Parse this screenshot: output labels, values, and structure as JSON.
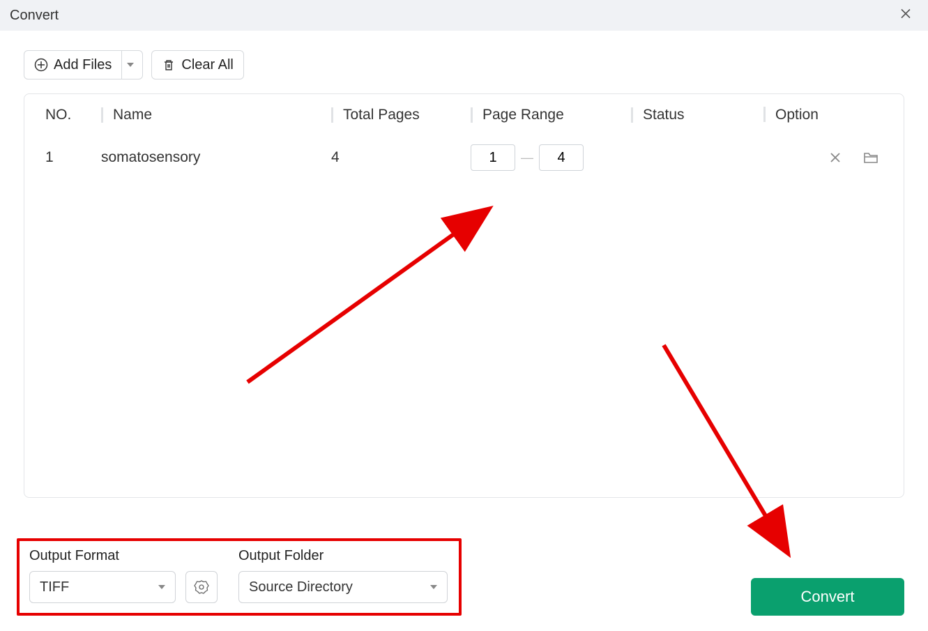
{
  "window": {
    "title": "Convert"
  },
  "toolbar": {
    "add_files_label": "Add Files",
    "clear_all_label": "Clear All"
  },
  "table": {
    "headers": {
      "no": "NO.",
      "name": "Name",
      "total_pages": "Total Pages",
      "page_range": "Page Range",
      "status": "Status",
      "option": "Option"
    },
    "rows": [
      {
        "no": "1",
        "name": "somatosensory",
        "total_pages": "4",
        "range_from": "1",
        "range_to": "4",
        "status": ""
      }
    ]
  },
  "output": {
    "format_label": "Output Format",
    "format_value": "TIFF",
    "folder_label": "Output Folder",
    "folder_value": "Source Directory"
  },
  "actions": {
    "convert_label": "Convert"
  },
  "annotation": {
    "color": "#e60000"
  }
}
